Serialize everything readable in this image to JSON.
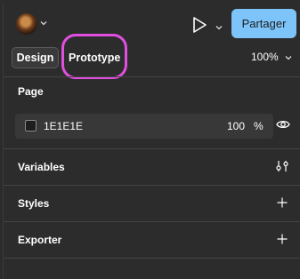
{
  "header": {
    "share_label": "Partager",
    "accent_color": "#7cc4fa",
    "icons": [
      "user-avatar",
      "chevron-down-icon",
      "play-icon",
      "chevron-down-icon"
    ]
  },
  "tabs": [
    {
      "label": "Design",
      "active": true
    },
    {
      "label": "Prototype",
      "active": false,
      "highlighted": true
    }
  ],
  "zoom": {
    "value": "100%"
  },
  "page": {
    "title": "Page",
    "fill_hex": "1E1E1E",
    "opacity": "100",
    "opacity_unit": "%",
    "visibility_icon": "eye-icon"
  },
  "sections": [
    {
      "label": "Variables",
      "icon": "sliders-icon"
    },
    {
      "label": "Styles",
      "icon": "plus-icon"
    },
    {
      "label": "Exporter",
      "icon": "plus-icon"
    }
  ],
  "highlight_color": "#e14fe0"
}
